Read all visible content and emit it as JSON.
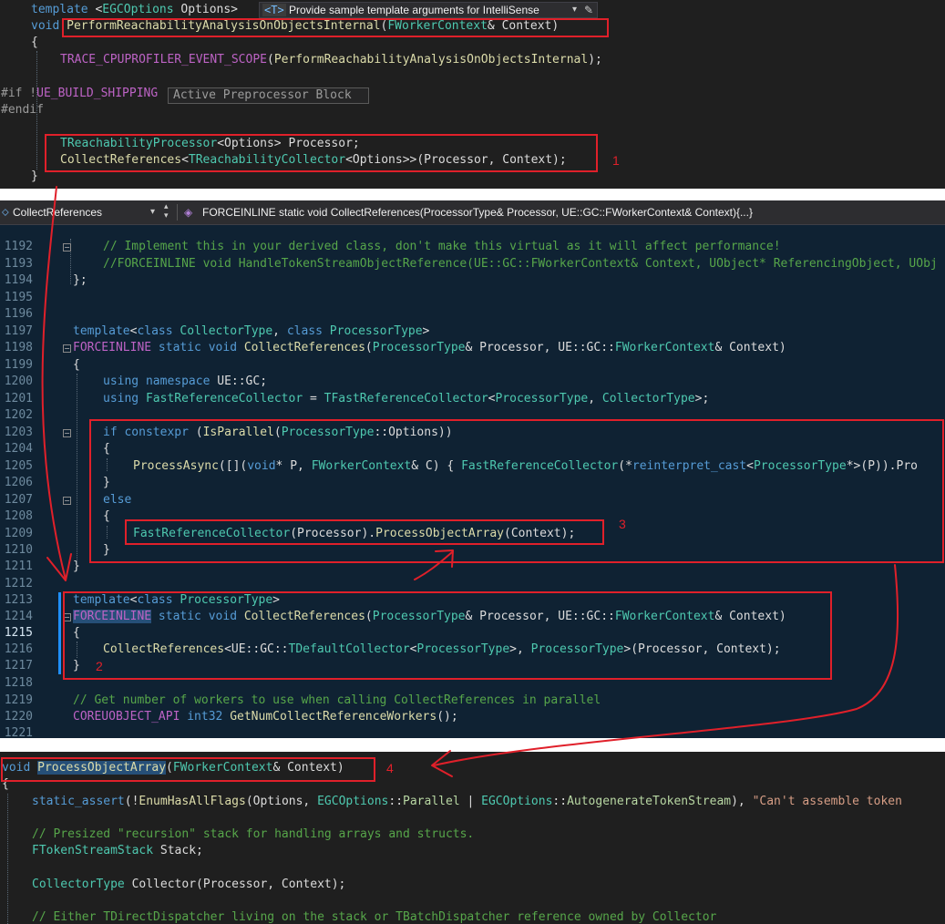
{
  "top_panel": {
    "hint_badge": "<T>",
    "hint_text": "Provide sample template arguments for IntelliSense",
    "preproc_tooltip": "Active Preprocessor Block"
  },
  "nav_bar": {
    "scope_dropdown": "CollectReferences",
    "member_dropdown": "FORCEINLINE static void CollectReferences(ProcessorType& Processor, UE::GC::FWorkerContext& Context){...}"
  },
  "line_numbers": [
    "1192",
    "1193",
    "1194",
    "1195",
    "1196",
    "1197",
    "1198",
    "1199",
    "1200",
    "1201",
    "1202",
    "1203",
    "1204",
    "1205",
    "1206",
    "1207",
    "1208",
    "1209",
    "1210",
    "1211",
    "1212",
    "1213",
    "1214",
    "1215",
    "1216",
    "1217",
    "1218",
    "1219",
    "1220",
    "1221"
  ],
  "annotations": [
    "1",
    "2",
    "3",
    "4"
  ],
  "colors": {
    "annotation": "#e0202a",
    "editor_bg": "#1f1f1f",
    "highlight_bg": "#0f2233"
  }
}
